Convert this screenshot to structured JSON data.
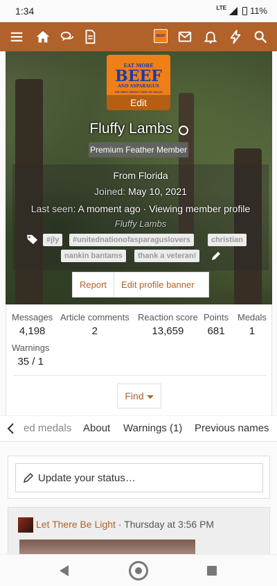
{
  "status_bar": {
    "time": "1:34",
    "network": "LTE",
    "battery": "11%"
  },
  "navbar": {
    "icons": [
      "menu-icon",
      "home-icon",
      "chat-icon",
      "document-icon",
      "avatar",
      "mail-icon",
      "bell-icon",
      "lightning-icon",
      "search-icon"
    ],
    "accent": "#b0622a"
  },
  "profile": {
    "avatar": {
      "line1": "EAT MORE",
      "line2": "BEEF",
      "line3": "AND ASPARAGUS",
      "line4": "THE WEST WASN'T WON ON SALAD",
      "edit_label": "Edit"
    },
    "username": "Fluffy Lambs",
    "user_title": "Premium Feather Member",
    "location": "From Florida",
    "joined_label": "Joined:",
    "joined_date": "May 10, 2021",
    "last_seen_label": "Last seen:",
    "last_seen_value": "A moment ago · Viewing member profile",
    "signature": "Fluffy Lambs",
    "tags": [
      "#jly",
      "#unitednationofasparaguslovers",
      "christian",
      "nankin bantams",
      "thank a veteran!"
    ],
    "report_label": "Report",
    "edit_banner_label": "Edit profile banner"
  },
  "stats": {
    "messages": {
      "label": "Messages",
      "value": "4,198"
    },
    "article_comments": {
      "label": "Article comments",
      "value": "2"
    },
    "reaction_score": {
      "label": "Reaction score",
      "value": "13,659"
    },
    "points": {
      "label": "Points",
      "value": "681"
    },
    "medals": {
      "label": "Medals",
      "value": "1"
    },
    "warnings": {
      "label": "Warnings",
      "value": "35 / 1"
    },
    "find_label": "Find"
  },
  "tabs": [
    "ed medals",
    "About",
    "Warnings (1)",
    "Previous names"
  ],
  "status_form": {
    "placeholder": "Update your status…"
  },
  "post": {
    "author": "Let There Be Light",
    "separator": " · ",
    "time": "Thursday at 3:56 PM"
  }
}
